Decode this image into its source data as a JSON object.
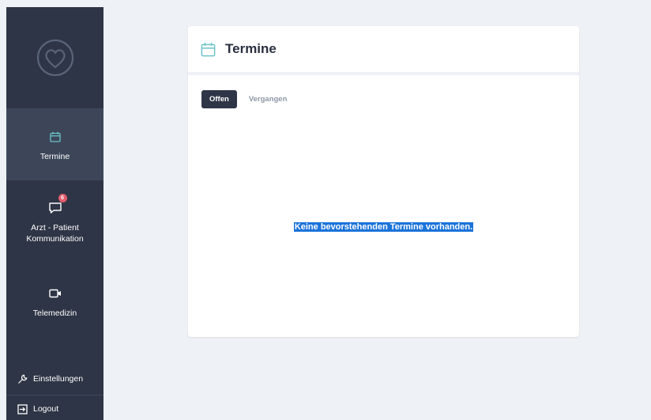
{
  "sidebar": {
    "logo_icon": "stethoscope-heart-icon",
    "nav": [
      {
        "label": "Termine",
        "icon": "calendar-icon",
        "active": true
      },
      {
        "label": "Arzt - Patient\nKommunikation",
        "icon": "chat-icon",
        "badge": "6"
      },
      {
        "label": "Telemedizin",
        "icon": "video-camera-icon"
      }
    ],
    "settings_label": "Einstellungen",
    "logout_label": "Logout"
  },
  "card": {
    "title": "Termine",
    "title_icon": "calendar-icon",
    "tabs": [
      {
        "label": "Offen",
        "active": true
      },
      {
        "label": "Vergangen",
        "active": false
      }
    ],
    "empty_message": "Keine bevorstehenden Termine vorhanden."
  },
  "colors": {
    "sidebar_bg": "#2e3546",
    "sidebar_active_bg": "#3d4659",
    "accent_teal": "#6cc3c9",
    "badge_red": "#e25b6b",
    "page_bg": "#eef1f5",
    "selection_blue": "#1a73d9"
  }
}
